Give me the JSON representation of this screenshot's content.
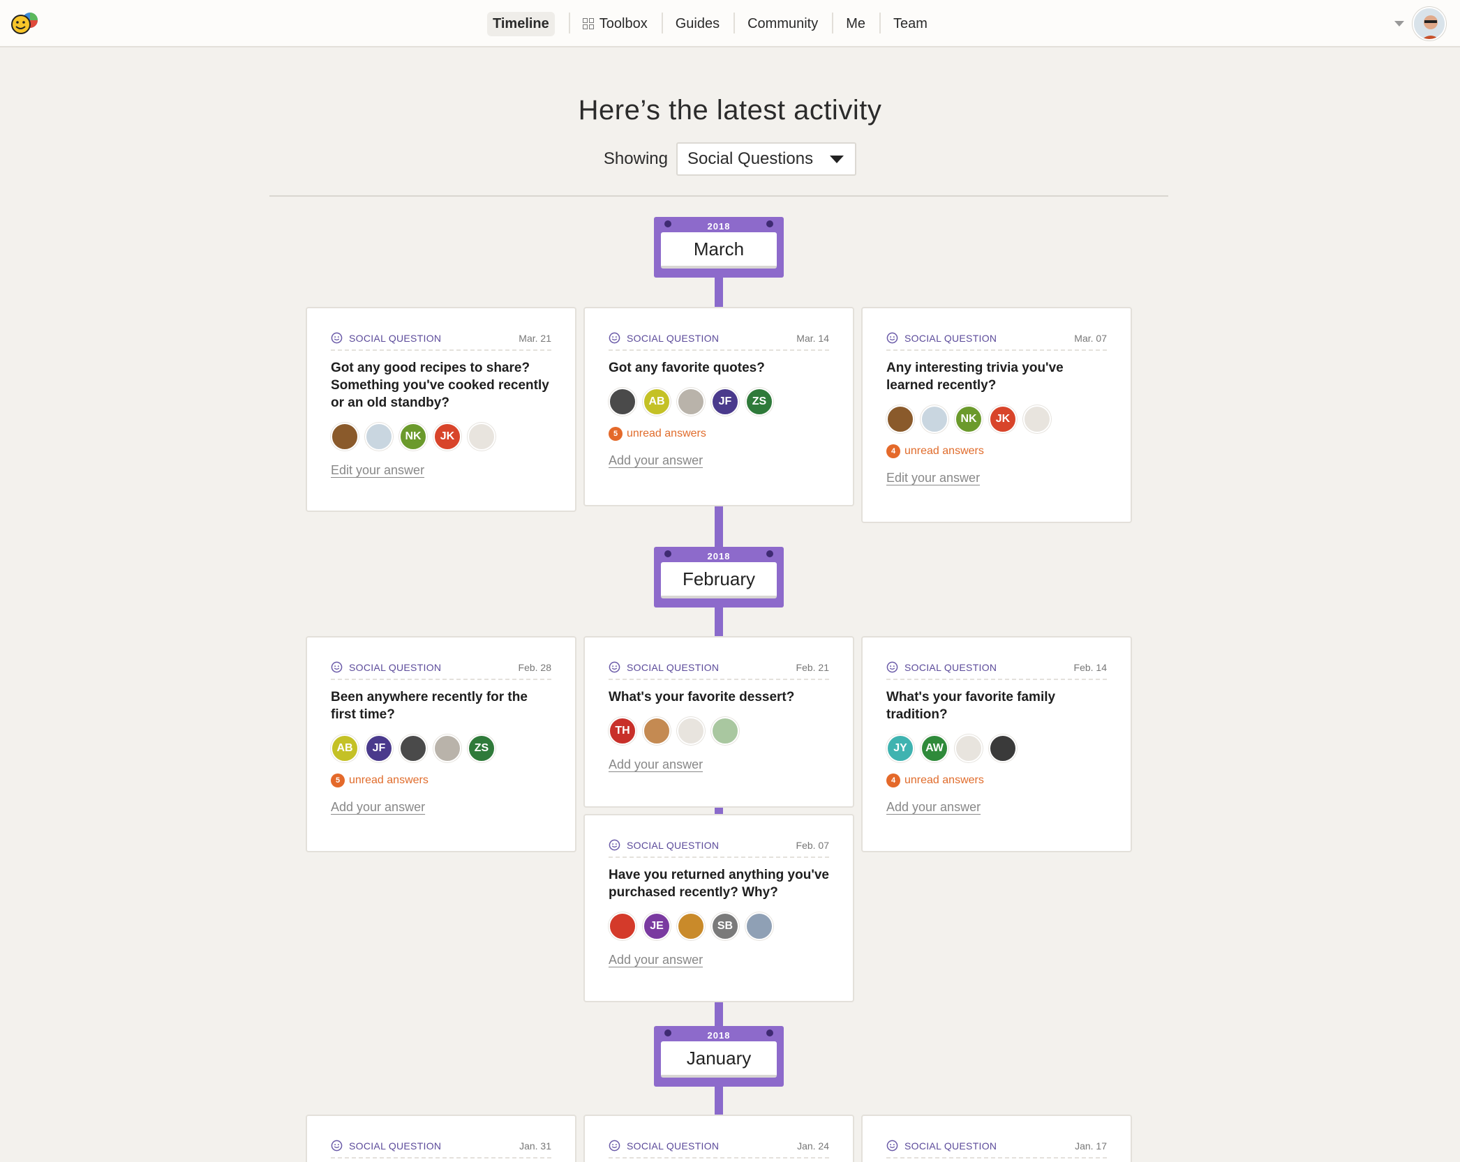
{
  "nav": {
    "items": [
      {
        "label": "Timeline",
        "active": true
      },
      {
        "label": "Toolbox",
        "icon": "grid-icon"
      },
      {
        "label": "Guides"
      },
      {
        "label": "Community"
      },
      {
        "label": "Me"
      },
      {
        "label": "Team"
      }
    ]
  },
  "header": {
    "title": "Here’s the latest activity",
    "showing_label": "Showing",
    "filter_value": "Social Questions"
  },
  "months": [
    {
      "year": "2018",
      "name": "March"
    },
    {
      "year": "2018",
      "name": "February"
    },
    {
      "year": "2018",
      "name": "January"
    }
  ],
  "cards": [
    {
      "tag": "SOCIAL QUESTION",
      "date": "Mar. 21",
      "question": "Got any good recipes to share? Something you've cooked recently or an old standby?",
      "avatars": [
        {
          "t": "",
          "c": "#8a5a2b"
        },
        {
          "t": "",
          "c": "#c9d6e0"
        },
        {
          "t": "NK",
          "c": "#6b9a2c"
        },
        {
          "t": "JK",
          "c": "#d8442a"
        },
        {
          "t": "",
          "c": "#e8e4de"
        }
      ],
      "unread": "",
      "unread_label": "",
      "link": "Edit your answer"
    },
    {
      "tag": "SOCIAL QUESTION",
      "date": "Mar. 14",
      "question": "Got any favorite quotes?",
      "avatars": [
        {
          "t": "",
          "c": "#4a4a4a"
        },
        {
          "t": "AB",
          "c": "#c4c126"
        },
        {
          "t": "",
          "c": "#b9b3aa"
        },
        {
          "t": "JF",
          "c": "#4a3a8c"
        },
        {
          "t": "ZS",
          "c": "#2f7a3a"
        }
      ],
      "unread": "5",
      "unread_label": "unread answers",
      "link": "Add your answer"
    },
    {
      "tag": "SOCIAL QUESTION",
      "date": "Mar. 07",
      "question": "Any interesting trivia you've learned recently?",
      "avatars": [
        {
          "t": "",
          "c": "#8a5a2b"
        },
        {
          "t": "",
          "c": "#c9d6e0"
        },
        {
          "t": "NK",
          "c": "#6b9a2c"
        },
        {
          "t": "JK",
          "c": "#d8442a"
        },
        {
          "t": "",
          "c": "#e8e4de"
        }
      ],
      "unread": "4",
      "unread_label": "unread answers",
      "link": "Edit your answer"
    },
    {
      "tag": "SOCIAL QUESTION",
      "date": "Feb. 28",
      "question": "Been anywhere recently for the first time?",
      "avatars": [
        {
          "t": "AB",
          "c": "#c4c126"
        },
        {
          "t": "JF",
          "c": "#4a3a8c"
        },
        {
          "t": "",
          "c": "#4a4a4a"
        },
        {
          "t": "",
          "c": "#b9b3aa"
        },
        {
          "t": "ZS",
          "c": "#2f7a3a"
        }
      ],
      "unread": "5",
      "unread_label": "unread answers",
      "link": "Add your answer"
    },
    {
      "tag": "SOCIAL QUESTION",
      "date": "Feb. 21",
      "question": "What's your favorite dessert?",
      "avatars": [
        {
          "t": "TH",
          "c": "#c8302a"
        },
        {
          "t": "",
          "c": "#c48a52"
        },
        {
          "t": "",
          "c": "#e8e4de"
        },
        {
          "t": "",
          "c": "#a9c7a0"
        }
      ],
      "unread": "",
      "unread_label": "",
      "link": "Add your answer"
    },
    {
      "tag": "SOCIAL QUESTION",
      "date": "Feb. 14",
      "question": "What's your favorite family tradition?",
      "avatars": [
        {
          "t": "JY",
          "c": "#3fb3b0"
        },
        {
          "t": "AW",
          "c": "#2f8a3a"
        },
        {
          "t": "",
          "c": "#e8e4de"
        },
        {
          "t": "",
          "c": "#3a3a3a"
        }
      ],
      "unread": "4",
      "unread_label": "unread answers",
      "link": "Add your answer"
    },
    {
      "tag": "SOCIAL QUESTION",
      "date": "Feb. 07",
      "question": "Have you returned anything you've purchased recently? Why?",
      "avatars": [
        {
          "t": "",
          "c": "#d43a2a"
        },
        {
          "t": "JE",
          "c": "#7a3aa0"
        },
        {
          "t": "",
          "c": "#c98a2a"
        },
        {
          "t": "SB",
          "c": "#7a7a7a"
        },
        {
          "t": "",
          "c": "#8fa0b5"
        }
      ],
      "unread": "",
      "unread_label": "",
      "link": "Add your answer"
    },
    {
      "tag": "SOCIAL QUESTION",
      "date": "Jan. 31",
      "question": "",
      "avatars": [],
      "unread": "",
      "unread_label": "",
      "link": ""
    },
    {
      "tag": "SOCIAL QUESTION",
      "date": "Jan. 24",
      "question": "",
      "avatars": [],
      "unread": "",
      "unread_label": "",
      "link": ""
    },
    {
      "tag": "SOCIAL QUESTION",
      "date": "Jan. 17",
      "question": "",
      "avatars": [],
      "unread": "",
      "unread_label": "",
      "link": ""
    }
  ],
  "colors": {
    "accent": "#8d6acb",
    "unread": "#e4692a",
    "tag": "#5b4a9a"
  }
}
